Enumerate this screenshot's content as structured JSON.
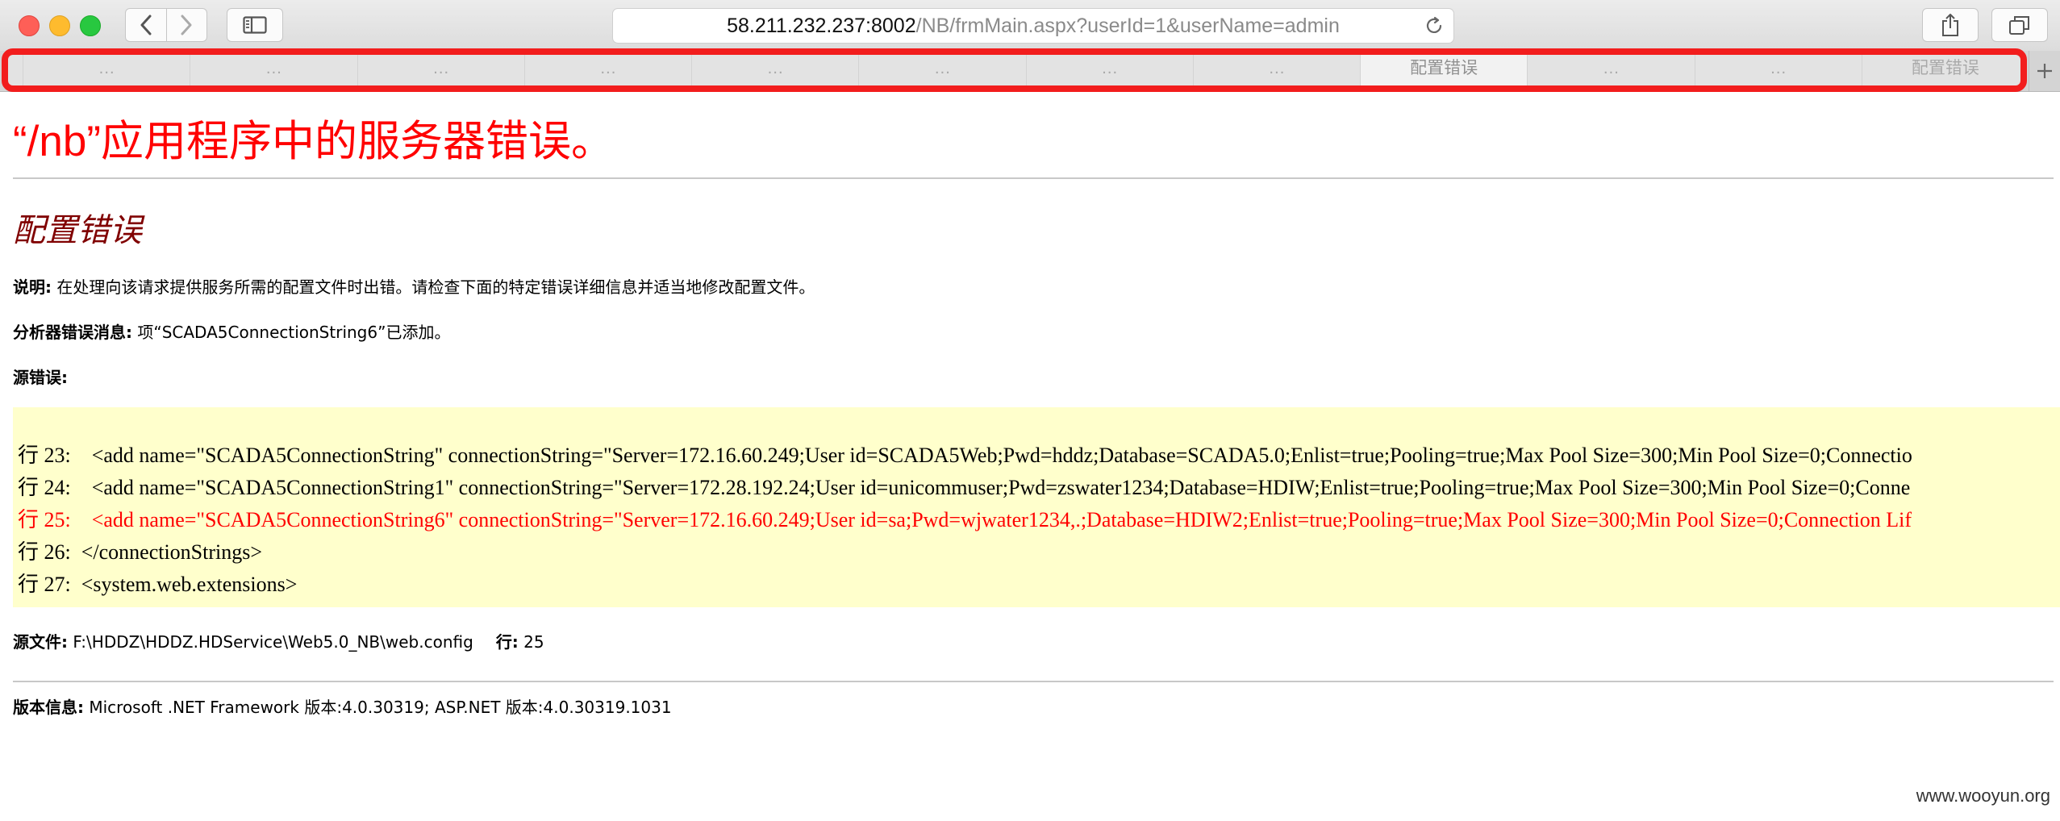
{
  "browser": {
    "url_host": "58.211.232.237:8002",
    "url_path": "/NB/frmMain.aspx?userId=1&userName=admin",
    "tabs": [
      {
        "label": "…",
        "active": false
      },
      {
        "label": "…",
        "active": false
      },
      {
        "label": "…",
        "active": false
      },
      {
        "label": "…",
        "active": false
      },
      {
        "label": "…",
        "active": false
      },
      {
        "label": "…",
        "active": false
      },
      {
        "label": "…",
        "active": false
      },
      {
        "label": "…",
        "active": false
      },
      {
        "label": "配置错误",
        "active": true
      },
      {
        "label": "…",
        "active": false
      },
      {
        "label": "…",
        "active": false
      },
      {
        "label": "配置错误",
        "active": false
      }
    ],
    "highlight_color": "#f21d1d"
  },
  "page": {
    "title": "“/nb”应用程序中的服务器错误。",
    "error_heading": "配置错误",
    "description_label": "说明:",
    "description_text": " 在处理向该请求提供服务所需的配置文件时出错。请检查下面的特定错误详细信息并适当地修改配置文件。",
    "parser_label": "分析器错误消息:",
    "parser_text": " 项“SCADA5ConnectionString6”已添加。",
    "source_error_label": "源错误:",
    "code_lines": [
      {
        "text": "行 23:    <add name=\"SCADA5ConnectionString\" connectionString=\"Server=172.16.60.249;User id=SCADA5Web;Pwd=hddz;Database=SCADA5.0;Enlist=true;Pooling=true;Max Pool Size=300;Min Pool Size=0;Connectio",
        "error": false
      },
      {
        "text": "行 24:    <add name=\"SCADA5ConnectionString1\" connectionString=\"Server=172.28.192.24;User id=unicommuser;Pwd=zswater1234;Database=HDIW;Enlist=true;Pooling=true;Max Pool Size=300;Min Pool Size=0;Conne",
        "error": false
      },
      {
        "text": "行 25:    <add name=\"SCADA5ConnectionString6\" connectionString=\"Server=172.16.60.249;User id=sa;Pwd=wjwater1234,.;Database=HDIW2;Enlist=true;Pooling=true;Max Pool Size=300;Min Pool Size=0;Connection Lif",
        "error": true
      },
      {
        "text": "行 26:  </connectionStrings>",
        "error": false
      },
      {
        "text": "行 27:  <system.web.extensions>",
        "error": false
      }
    ],
    "source_file_label": "源文件:",
    "source_file_path": " F:\\HDDZ\\HDDZ.HDService\\Web5.0_NB\\web.config",
    "line_label": "行:",
    "line_number": " 25",
    "version_label": "版本信息:",
    "version_text": " Microsoft .NET Framework 版本:4.0.30319; ASP.NET 版本:4.0.30319.1031",
    "watermark": "www.wooyun.org"
  }
}
